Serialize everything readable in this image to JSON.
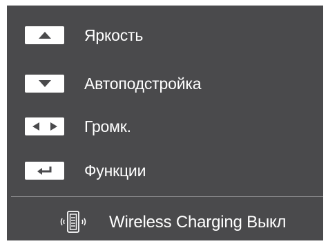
{
  "menu": {
    "items": [
      {
        "label": "Яркость",
        "key_icon": "up-arrow-icon"
      },
      {
        "label": "Автоподстройка",
        "key_icon": "down-arrow-icon"
      },
      {
        "label": "Громк.",
        "key_icon": "left-right-arrows-icon"
      },
      {
        "label": "Функции",
        "key_icon": "enter-return-icon"
      }
    ],
    "wireless_charging": {
      "label": "Wireless Charging Выкл",
      "icon": "wireless-charging-phone-icon"
    }
  },
  "colors": {
    "panel_background": "#4a4a4c",
    "text": "#ffffff",
    "key_background": "#ffffff",
    "key_glyph": "#4a4a4c",
    "divider": "#8a8a8c"
  }
}
